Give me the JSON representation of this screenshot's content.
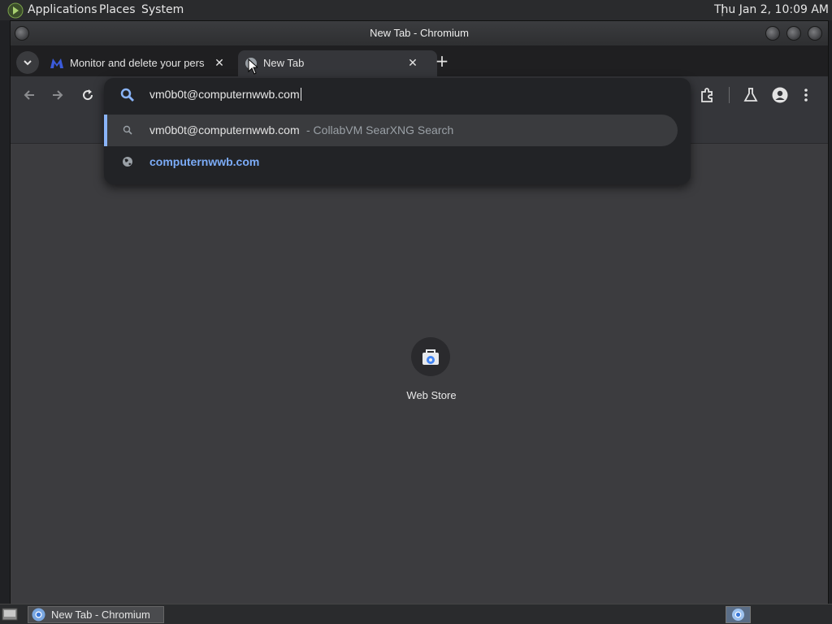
{
  "top_panel": {
    "menus": [
      "Applications",
      "Places",
      "System"
    ],
    "clock": "Thu Jan  2, 10:09 AM"
  },
  "window": {
    "title": "New Tab - Chromium"
  },
  "tabs": [
    {
      "title": "Monitor and delete your pers",
      "close": "✕"
    },
    {
      "title": "New Tab",
      "close": "✕"
    }
  ],
  "new_tab_symbol": "+",
  "omnibox": {
    "input_value": "vm0b0t@computernwwb.com",
    "suggestions": [
      {
        "text": "vm0b0t@computernwwb.com",
        "suffix": " - CollabVM SearXNG Search",
        "icon": "search-icon"
      },
      {
        "text": "computernwwb.com",
        "icon": "globe-icon"
      }
    ]
  },
  "content": {
    "shortcut_label": "Web Store"
  },
  "taskbar": {
    "task_label": "New Tab - Chromium"
  },
  "colors": {
    "accent": "#8ab4f8",
    "link": "#7cacf8"
  }
}
